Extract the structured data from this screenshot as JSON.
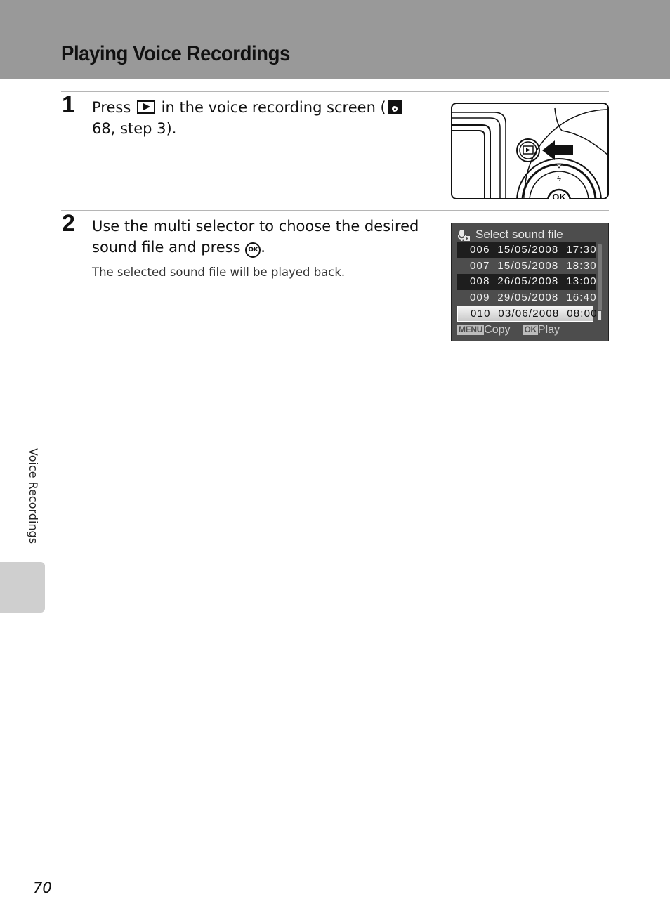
{
  "header": {
    "title": "Playing Voice Recordings",
    "band_color": "#999999"
  },
  "steps": [
    {
      "number": "1",
      "text_before_icon": "Press ",
      "icon": "playback-button-icon",
      "text_after_icon": " in the voice recording screen (",
      "ref_icon": "page-reference-icon",
      "text_end": " 68, step 3).",
      "illustration": "camera-back-playback-button-illustration"
    },
    {
      "number": "2",
      "text_before_icon": "Use the multi selector to choose the desired sound file and press ",
      "icon": "ok-button-icon",
      "icon_text": "OK",
      "text_end": ".",
      "note": "The selected sound file will be played back."
    }
  ],
  "lcd_screen": {
    "title": "Select sound file",
    "title_icon": "voice-recording-icon",
    "files": [
      {
        "num": "006",
        "date": "15/05/2008",
        "time": "17:30",
        "style": "dark"
      },
      {
        "num": "007",
        "date": "15/05/2008",
        "time": "18:30",
        "style": "normal"
      },
      {
        "num": "008",
        "date": "26/05/2008",
        "time": "13:00",
        "style": "dark"
      },
      {
        "num": "009",
        "date": "29/05/2008",
        "time": "16:40",
        "style": "normal"
      },
      {
        "num": "010",
        "date": "03/06/2008",
        "time": "08:00",
        "style": "selected"
      }
    ],
    "footer": {
      "menu_badge": "MENU",
      "menu_label": "Copy",
      "ok_badge": "OK",
      "ok_label": "Play"
    }
  },
  "side_tab": {
    "label": "Voice Recordings"
  },
  "page_number": "70"
}
